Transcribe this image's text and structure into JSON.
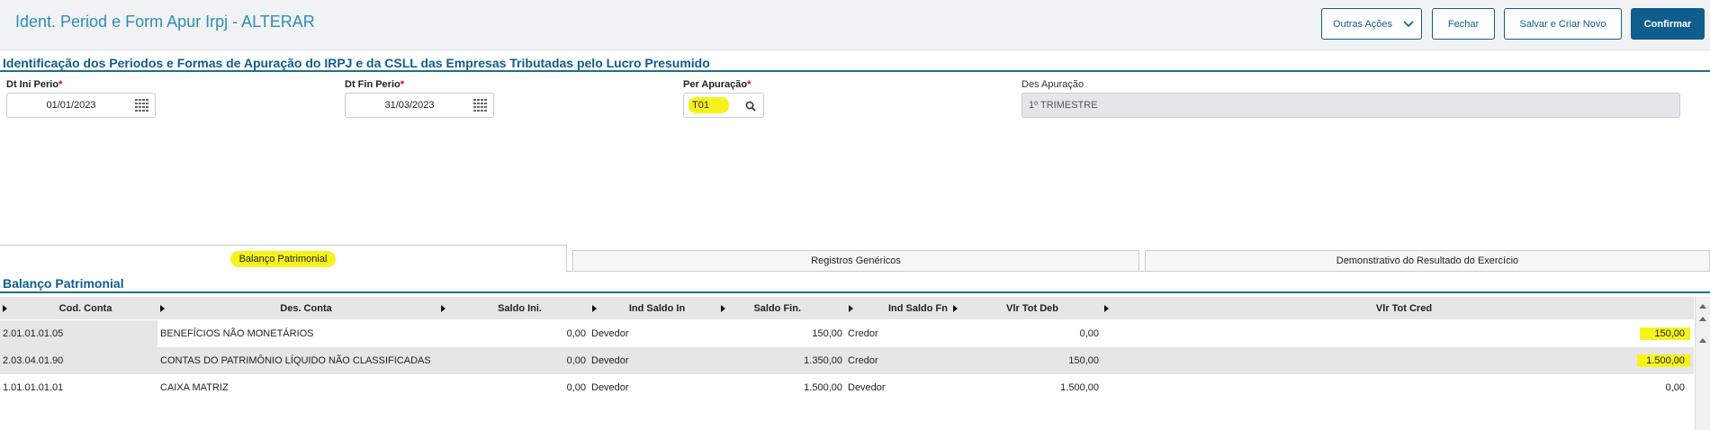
{
  "header": {
    "title": "Ident. Period e Form Apur Irpj - ALTERAR",
    "buttons": {
      "outras": "Outras Ações",
      "fechar": "Fechar",
      "salvar": "Salvar e Criar Novo",
      "confirmar": "Confirmar"
    },
    "icons": {
      "dropdown": "chevron-down-icon"
    }
  },
  "section1": {
    "title": "Identificação dos Periodos e Formas de Apuração do IRPJ e da CSLL das Empresas Tributadas pelo Lucro Presumido"
  },
  "fields": {
    "dt_ini": {
      "label": "Dt Ini Perio",
      "required": "*",
      "value": "01/01/2023",
      "icon": "calendar-icon"
    },
    "dt_fin": {
      "label": "Dt Fin Perio",
      "required": "*",
      "value": "31/03/2023",
      "icon": "calendar-icon"
    },
    "per_apur": {
      "label": "Per Apuração",
      "required": "*",
      "value": "T01",
      "icon": "search-icon"
    },
    "des_apur": {
      "label": "Des Apuração",
      "value": "1º TRIMESTRE"
    }
  },
  "tabs": [
    "Balanço Patrimonial",
    "Registros Genéricos",
    "Demonstrativo do Resultado do Exercício"
  ],
  "section2": {
    "title": "Balanço Patrimonial"
  },
  "table": {
    "columns": [
      "Cod. Conta",
      "Des. Conta",
      "Saldo Ini.",
      "Ind Saldo In",
      "Saldo Fin.",
      "Ind Saldo Fn",
      "Vlr Tot Deb",
      "Vlr Tot Cred"
    ],
    "rows": [
      [
        "2.01.01.01.05",
        "BENEFÍCIOS NÃO MONETÁRIOS",
        "0,00",
        "Devedor",
        "150,00",
        "Credor",
        "0,00",
        "150,00"
      ],
      [
        "2.03.04.01.90",
        "CONTAS DO PATRIMÔNIO LÍQUIDO NÃO CLASSIFICADAS",
        "0,00",
        "Devedor",
        "1.350,00",
        "Credor",
        "150,00",
        "1.500,00"
      ],
      [
        "1.01.01.01.01",
        "CAIXA MATRIZ",
        "0,00",
        "Devedor",
        "1.500,00",
        "Devedor",
        "1.500,00",
        "0,00"
      ]
    ]
  },
  "colors": {
    "accent": "#0f5d8c",
    "title": "#2c8fb6",
    "highlight": "#f6f31c",
    "row_alt": "#e6e6e6"
  }
}
